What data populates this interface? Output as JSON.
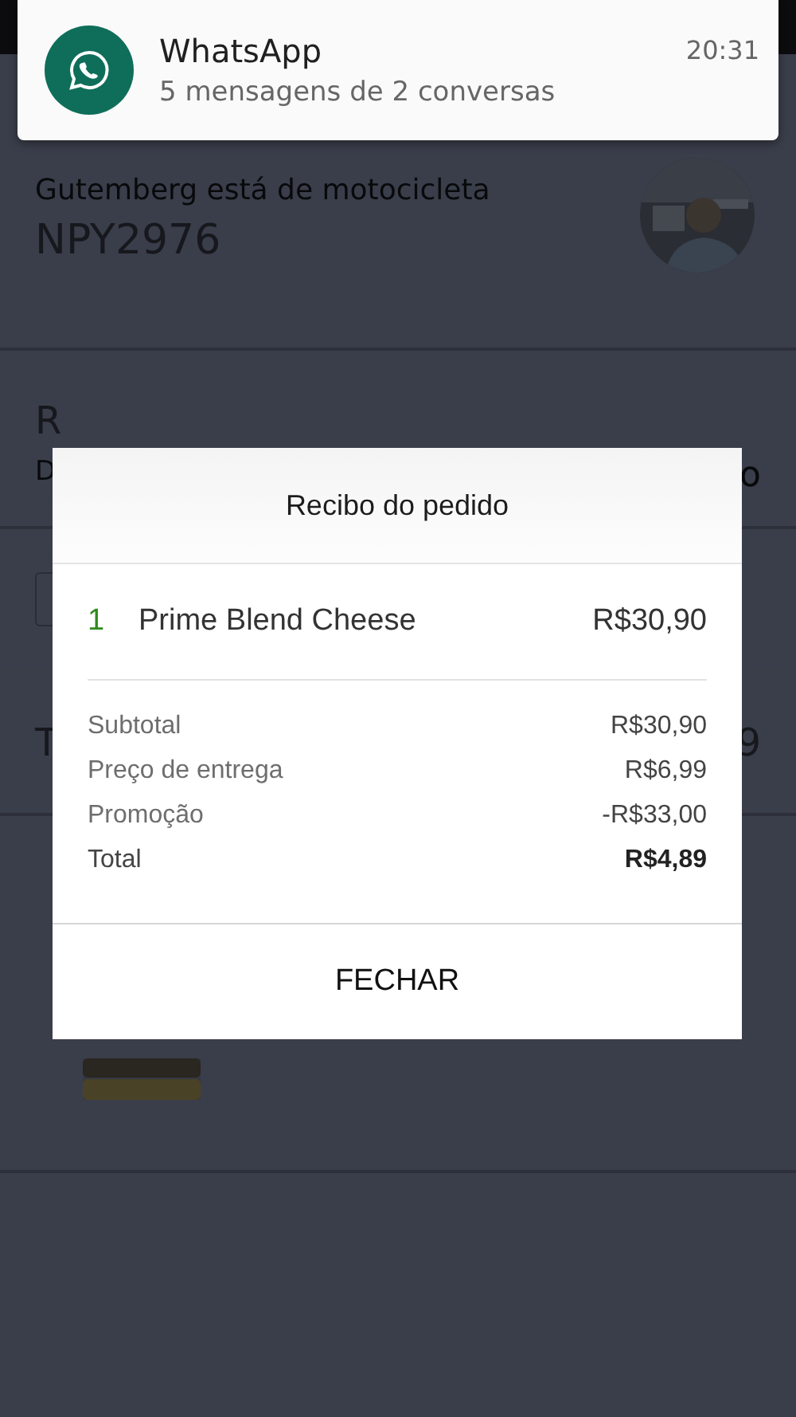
{
  "notification": {
    "app": "WhatsApp",
    "text": "5 mensagens de 2 conversas",
    "time": "20:31"
  },
  "background": {
    "driver_status": "Gutemberg está de motocicleta",
    "plate": "NPY2976",
    "fragment_1": "R",
    "fragment_2": "D",
    "fragment_3": "o",
    "fragment_4": "T",
    "fragment_5": "9"
  },
  "dialog": {
    "title": "Recibo do pedido",
    "items": [
      {
        "quantity": "1",
        "name": "Prime Blend Cheese",
        "price": "R$30,90"
      }
    ],
    "summary": [
      {
        "label": "Subtotal",
        "value": "R$30,90",
        "kind": "normal"
      },
      {
        "label": "Preço de entrega",
        "value": "R$6,99",
        "kind": "normal"
      },
      {
        "label": "Promoção",
        "value": "-R$33,00",
        "kind": "normal"
      },
      {
        "label": "Total",
        "value": "R$4,89",
        "kind": "total"
      }
    ],
    "button": "FECHAR"
  }
}
